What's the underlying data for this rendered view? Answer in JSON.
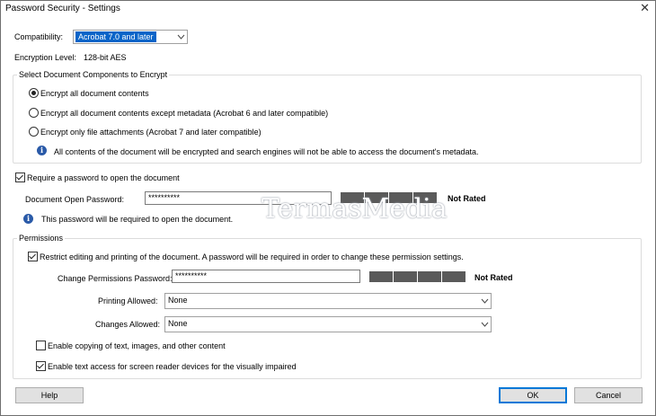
{
  "window": {
    "title": "Password Security - Settings",
    "close_glyph": "✕"
  },
  "compatibility": {
    "label": "Compatibility:",
    "value": "Acrobat 7.0 and later"
  },
  "encryption": {
    "label": "Encryption  Level:",
    "value": "128-bit AES"
  },
  "components": {
    "group_label": "Select Document Components to Encrypt",
    "options": [
      {
        "label": "Encrypt all document contents",
        "selected": true
      },
      {
        "label": "Encrypt all document contents except metadata (Acrobat 6 and later compatible)",
        "selected": false
      },
      {
        "label": "Encrypt only file attachments (Acrobat 7 and later compatible)",
        "selected": false
      }
    ],
    "info": "All contents of the document will be encrypted and search engines will not be able to access the document's metadata."
  },
  "open_password": {
    "checkbox_label": "Require a password to open the document",
    "checked": true,
    "field_label": "Document Open Password:",
    "value": "**********",
    "rating": "Not Rated",
    "info": "This password will be required to open the document."
  },
  "permissions": {
    "group_label": "Permissions",
    "restrict_label": "Restrict editing and printing of the document. A password will be required in order to change these permission settings.",
    "restrict_checked": true,
    "field_label": "Change Permissions Password:",
    "value": "**********",
    "rating": "Not Rated",
    "printing_label": "Printing Allowed:",
    "printing_value": "None",
    "changes_label": "Changes Allowed:",
    "changes_value": "None",
    "copy_label": "Enable copying of text, images, and other content",
    "copy_checked": false,
    "access_label": "Enable text access for screen reader devices for the visually impaired",
    "access_checked": true
  },
  "buttons": {
    "help": "Help",
    "ok": "OK",
    "cancel": "Cancel"
  },
  "watermark": "TermasMedia",
  "colors": {
    "meter": "#5a5a5a",
    "selection": "#0a64c8",
    "info": "#2a5aa8"
  }
}
